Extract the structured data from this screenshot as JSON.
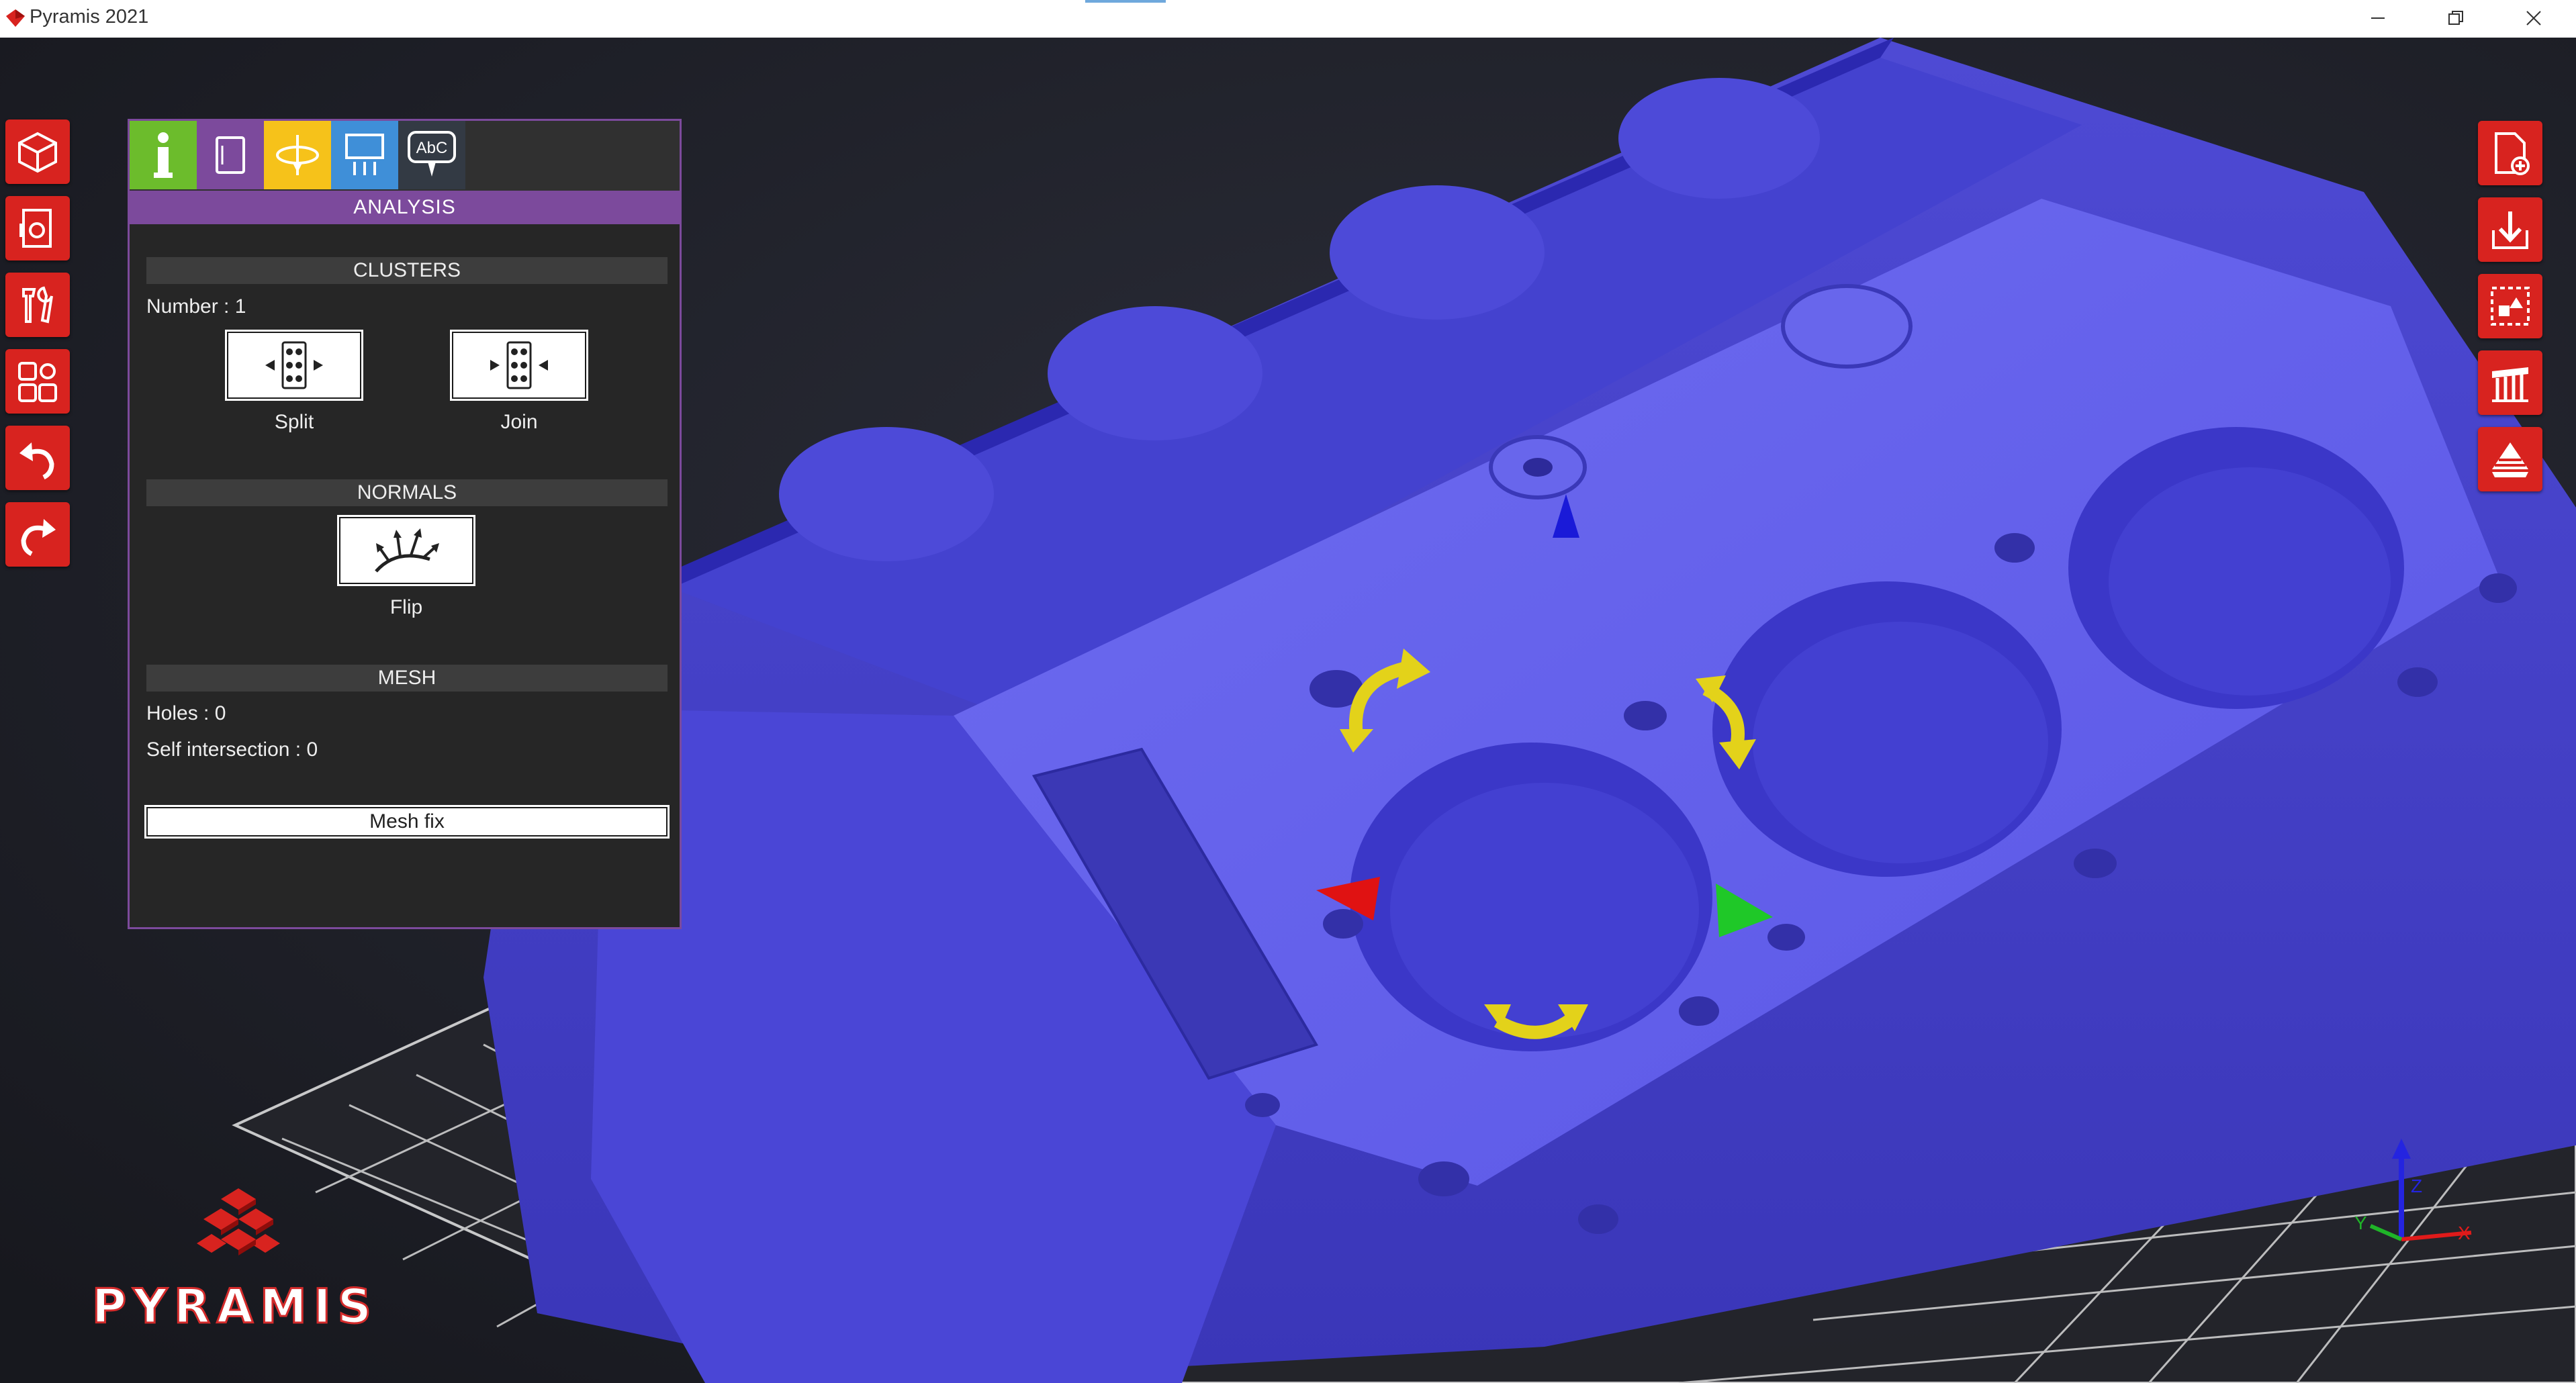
{
  "window": {
    "title": "Pyramis 2021"
  },
  "panel": {
    "title": "ANALYSIS",
    "tabs": [
      "info",
      "layer",
      "orientation",
      "supports",
      "text"
    ],
    "clusters": {
      "heading": "CLUSTERS",
      "number_text": "Number : 1",
      "split_label": "Split",
      "join_label": "Join"
    },
    "normals": {
      "heading": "NORMALS",
      "flip_label": "Flip"
    },
    "mesh": {
      "heading": "MESH",
      "holes_text": "Holes : 0",
      "self_intersection_text": "Self intersection : 0",
      "mesh_fix_label": "Mesh fix"
    }
  },
  "left_toolbar": [
    "view-cube-icon",
    "page-view-icon",
    "tools-icon",
    "settings-grid-icon",
    "undo-icon",
    "redo-icon"
  ],
  "right_toolbar": [
    "add-file-icon",
    "import-icon",
    "arrange-icon",
    "supports-icon",
    "layers-icon"
  ],
  "brand": {
    "name": "PYRAMIS"
  },
  "axis": {
    "x": "X",
    "y": "Y",
    "z": "Z"
  },
  "colors": {
    "accent_red": "#d8231f",
    "panel_purple": "#7c4a9c",
    "model_blue": "#5a56e8",
    "tab_green": "#6cbc2c",
    "tab_yellow": "#f6c21a",
    "tab_blue": "#3f8fd8"
  }
}
